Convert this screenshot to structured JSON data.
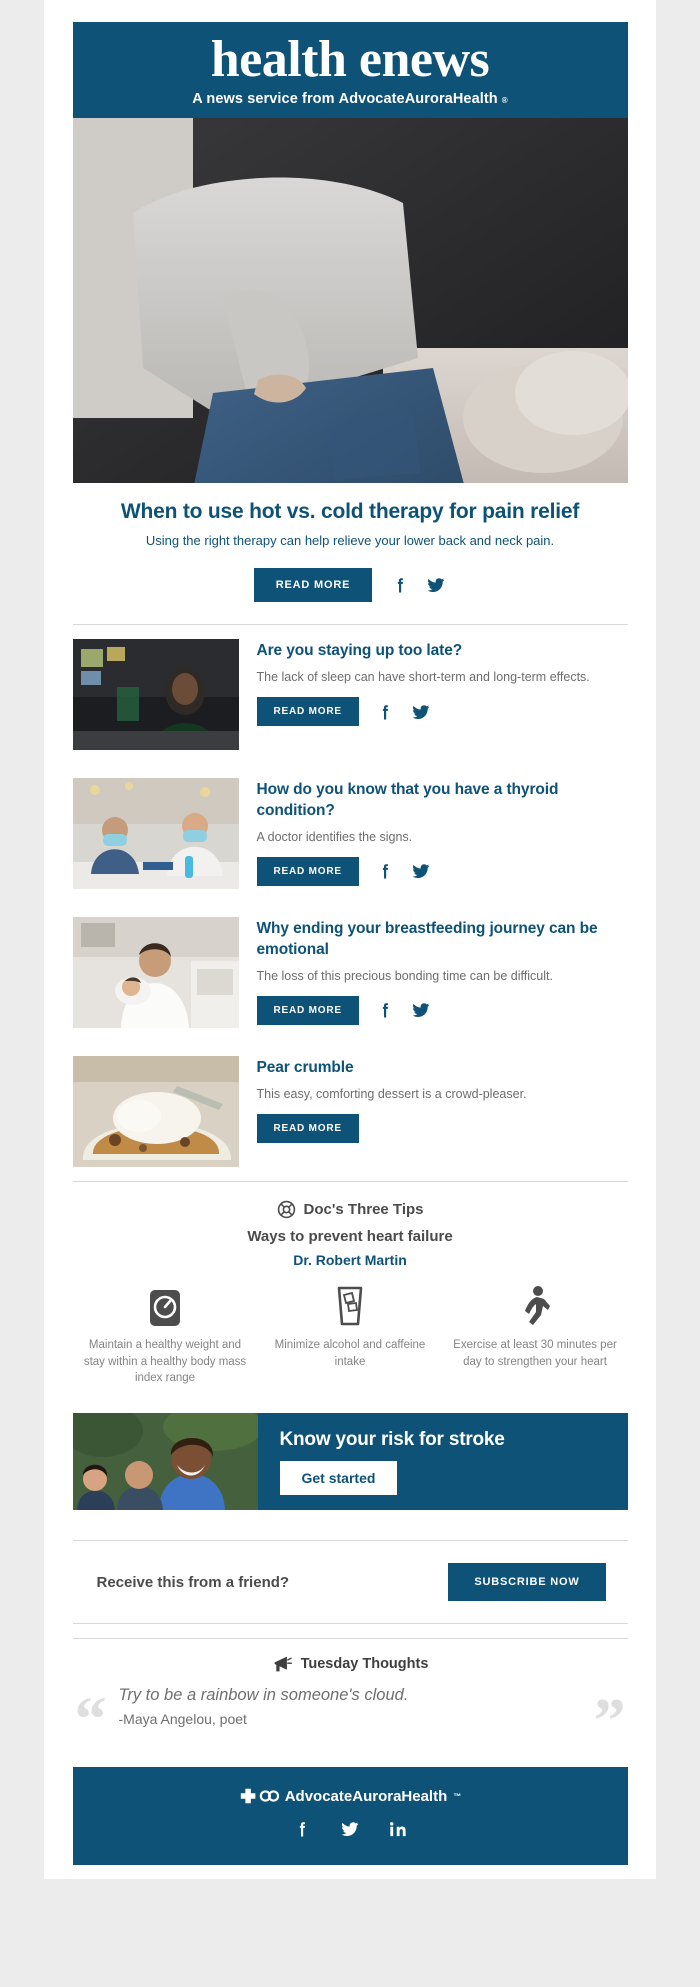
{
  "masthead": {
    "title": "health enews",
    "subtitle_prefix": "A news service from",
    "brand": "AdvocateAuroraHealth",
    "tm": "®"
  },
  "colors": {
    "brand_blue": "#0e5277",
    "page_bg": "#ececec",
    "body_text": "#6d6d6d",
    "muted": "#848484"
  },
  "hero": {
    "title": "When to use hot vs. cold therapy for pain relief",
    "description": "Using the right therapy can help relieve your lower back and neck pain.",
    "read_more": "READ MORE",
    "image_alt": "Woman holding her lower back in pain"
  },
  "articles": [
    {
      "title": "Are you staying up too late?",
      "description": "The lack of sleep can have short-term and long-term effects.",
      "read_more": "READ MORE",
      "image_alt": "Man working late at a desk in a dark room",
      "has_share": true
    },
    {
      "title": "How do you know that you have a thyroid condition?",
      "description": "A doctor identifies the signs.",
      "read_more": "READ MORE",
      "image_alt": "Doctor in mask consulting with a masked patient",
      "has_share": true
    },
    {
      "title": "Why ending your breastfeeding journey can be emotional",
      "description": "The loss of this precious bonding time can be difficult.",
      "read_more": "READ MORE",
      "image_alt": "Mother holding her baby in a kitchen",
      "has_share": true
    },
    {
      "title": "Pear crumble",
      "description": "This easy, comforting dessert is a crowd-pleaser.",
      "read_more": "READ MORE",
      "image_alt": "Bowl of pear crumble with ice cream",
      "has_share": false
    }
  ],
  "tips": {
    "heading": "Doc's Three Tips",
    "subheading": "Ways to prevent heart failure",
    "doctor": "Dr. Robert Martin",
    "items": [
      {
        "icon": "scale-icon",
        "text": "Maintain a healthy weight and stay within a healthy body mass index range"
      },
      {
        "icon": "drink-glass-icon",
        "text": "Minimize alcohol and caffeine intake"
      },
      {
        "icon": "walking-person-icon",
        "text": "Exercise at least 30 minutes per day to strengthen your heart"
      }
    ]
  },
  "promo": {
    "title": "Know your risk for stroke",
    "button": "Get started",
    "image_alt": "Group of people laughing outdoors"
  },
  "subscribe": {
    "text": "Receive this from a friend?",
    "button": "SUBSCRIBE NOW"
  },
  "thoughts": {
    "heading": "Tuesday Thoughts",
    "quote": "Try to be a rainbow in someone's cloud.",
    "author": "-Maya Angelou, poet",
    "open_quote": "“",
    "close_quote": "”"
  },
  "footer": {
    "brand": "AdvocateAuroraHealth",
    "tm": "™",
    "socials": [
      "facebook-icon",
      "twitter-icon",
      "linkedin-icon"
    ]
  },
  "social_labels": {
    "facebook": "f",
    "twitter": "twitter-icon",
    "linkedin": "in"
  }
}
